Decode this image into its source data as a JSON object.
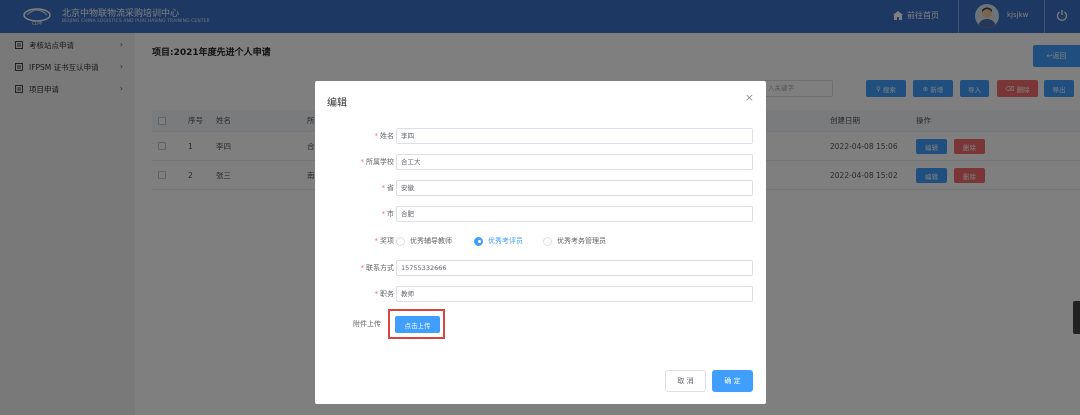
{
  "header": {
    "org_title": "北京中物联物流采购培训中心",
    "org_subtitle": "BEIJING CHINA LOGISTICS AND PURCHASING TRAINING CENTER",
    "home_label": "前往首页",
    "username": "kjsjkw"
  },
  "sidebar": {
    "items": [
      {
        "label": "考核站点申请"
      },
      {
        "label": "IFPSM 证书互认申请"
      },
      {
        "label": "项目申请"
      }
    ]
  },
  "main": {
    "project_title": "项目:2021年度先进个人申请",
    "back_label": "返回",
    "search_placeholder": "入关键字",
    "toolbar": {
      "search_label": "搜索",
      "add_label": "新增",
      "import_label": "导入",
      "delete_label": "删除",
      "export_label": "导出"
    },
    "table": {
      "headers": {
        "index": "序号",
        "name": "姓名",
        "col3": "所",
        "created": "创建日期",
        "actions": "操作"
      },
      "rows": [
        {
          "index": "1",
          "name": "李四",
          "col3": "合",
          "created": "2022-04-08 15:06",
          "edit": "编辑",
          "delete": "删除"
        },
        {
          "index": "2",
          "name": "张三",
          "col3": "南",
          "created": "2022-04-08 15:02",
          "edit": "编辑",
          "delete": "删除"
        }
      ]
    }
  },
  "dialog": {
    "title": "编辑",
    "fields": {
      "name": {
        "label": "姓名",
        "value": "李四"
      },
      "school": {
        "label": "所属学校",
        "value": "合工大"
      },
      "province": {
        "label": "省",
        "value": "安徽"
      },
      "city": {
        "label": "市",
        "value": "合肥"
      },
      "award": {
        "label": "奖项",
        "options": [
          "优秀辅导教师",
          "优秀考评员",
          "优秀考务管理员"
        ],
        "selected": "优秀考评员"
      },
      "phone": {
        "label": "联系方式",
        "value": "15755332666"
      },
      "position": {
        "label": "职务",
        "value": "教师"
      }
    },
    "upload": {
      "label": "附件上传",
      "button": "点击上传"
    },
    "cancel_label": "取 消",
    "ok_label": "确 定"
  },
  "colors": {
    "header_bg": "#3b73c7",
    "primary": "#409eff",
    "danger": "#f56c6c",
    "highlight_box": "#d9443c"
  }
}
